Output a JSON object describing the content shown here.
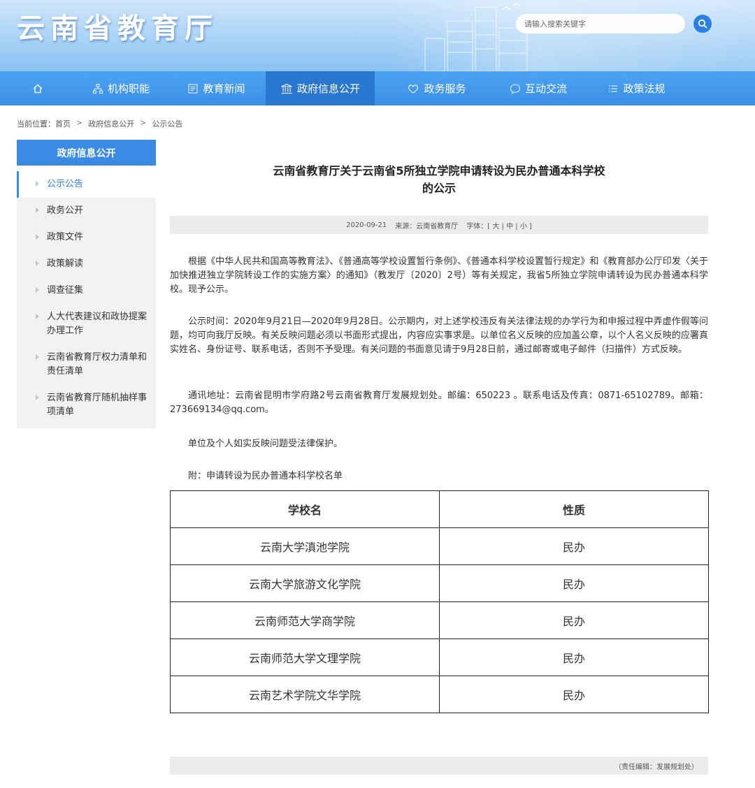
{
  "header": {
    "site_title": "云南省教育厅",
    "search_placeholder": "请输入搜索关键字",
    "search_icon": "search-icon"
  },
  "nav": {
    "items": [
      {
        "label": "",
        "icon": "home-icon"
      },
      {
        "label": "机构职能",
        "icon": "org-icon"
      },
      {
        "label": "教育新闻",
        "icon": "news-icon"
      },
      {
        "label": "政府信息公开",
        "icon": "building-icon"
      },
      {
        "label": "政务服务",
        "icon": "service-icon"
      },
      {
        "label": "互动交流",
        "icon": "chat-icon"
      },
      {
        "label": "政策法规",
        "icon": "list-icon"
      }
    ],
    "active_index": 3,
    "colors": {
      "bar": "#3a8fe6",
      "active": "#2a77cf"
    }
  },
  "breadcrumb": {
    "prefix": "当前位置：首页",
    "sep": ">",
    "level2": "政府信息公开",
    "level3": "公示公告"
  },
  "sidebar": {
    "title": "政府信息公开",
    "items": [
      {
        "label": "公示公告",
        "active": true
      },
      {
        "label": "政务公开"
      },
      {
        "label": "政策文件"
      },
      {
        "label": "政策解读"
      },
      {
        "label": "调查征集"
      },
      {
        "label": "人大代表建议和政协提案办理工作"
      },
      {
        "label": "云南省教育厅权力清单和责任清单"
      },
      {
        "label": "云南省教育厅随机抽样事项清单"
      }
    ]
  },
  "article": {
    "title_line1": "云南省教育厅关于云南省5所独立学院申请转设为民办普通本科学校",
    "title_line2": "的公示",
    "meta": {
      "date": "2020-09-21",
      "source": "来源：云南省教育厅",
      "font_label": "字体：[",
      "font_large": "大",
      "font_mid": "中",
      "font_small": "小",
      "sep": "|",
      "close": "]"
    },
    "p1": "根据《中华人民共和国高等教育法》、《普通高等学校设置暂行条例》、《普通本科学校设置暂行规定》和《教育部办公厅印发〈关于加快推进独立学院转设工作的实施方案〉的通知》（教发厅〔2020〕2号）等有关规定，我省5所独立学院申请转设为民办普通本科学校。现予公示。",
    "p2": "公示时间：2020年9月21日—2020年9月28日。公示期内，对上述学校违反有关法律法规的办学行为和申报过程中弄虚作假等问题，均可向我厅反映。有关反映问题必须以书面形式提出，内容应实事求是。以单位名义反映的应加盖公章，以个人名义反映的应署真实姓名、身份证号、联系电话，否则不予受理。有关问题的书面意见请于9月28日前，通过邮寄或电子邮件（扫描件）方式反映。",
    "p3": "通讯地址：云南省昆明市学府路2号云南省教育厅发展规划处。邮编：650223 。联系电话及传真：0871-65102789。邮箱：273669134@qq.com。",
    "p4": "单位及个人如实反映问题受法律保护。",
    "p5": "附：申请转设为民办普通本科学校名单",
    "table": {
      "headers": [
        "学校名",
        "性质"
      ],
      "rows": [
        [
          "云南大学滇池学院",
          "民办"
        ],
        [
          "云南大学旅游文化学院",
          "民办"
        ],
        [
          "云南师范大学商学院",
          "民办"
        ],
        [
          "云南师范大学文理学院",
          "民办"
        ],
        [
          "云南艺术学院文华学院",
          "民办"
        ]
      ]
    },
    "editor": "（责任编辑：发展规划处）"
  }
}
